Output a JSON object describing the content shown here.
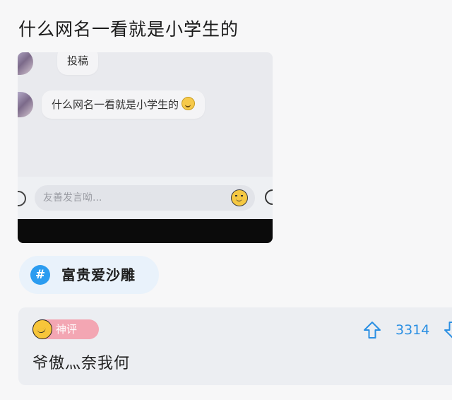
{
  "post": {
    "title": "什么网名一看就是小学生的"
  },
  "chat_screenshot": {
    "messages": [
      {
        "text": "投稿"
      },
      {
        "text": "什么网名一看就是小学生的",
        "emoji": "grinning-emoji"
      }
    ],
    "input": {
      "placeholder": "友善发言呦..."
    }
  },
  "topic": {
    "label": "富贵爱沙雕",
    "icon": "hash-icon",
    "color": "#2b9cf0"
  },
  "comment": {
    "badge": "神评",
    "badge_color": "#f3a6b3",
    "text": "爷傲灬奈我何",
    "upvotes": "3314",
    "accent": "#2a8fe3"
  }
}
